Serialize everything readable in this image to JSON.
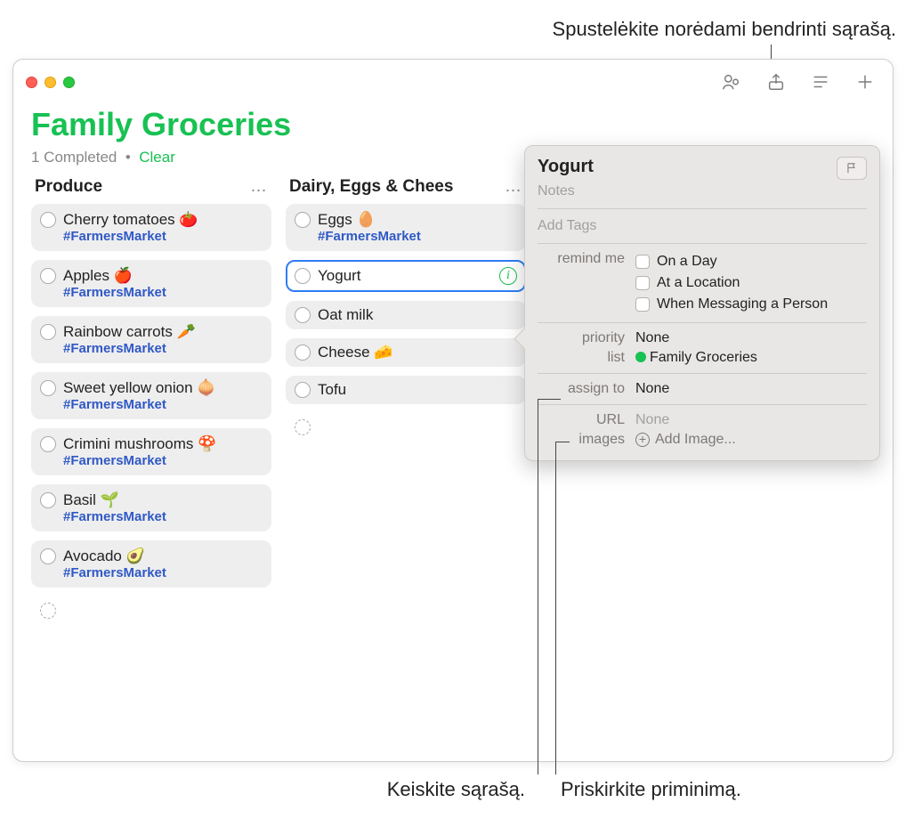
{
  "annotations": {
    "top": "Spustelėkite norėdami bendrinti sąrašą.",
    "bottom_left": "Keiskite sąrašą.",
    "bottom_right": "Priskirkite priminimą."
  },
  "list": {
    "title": "Family Groceries",
    "completed_count": "1 Completed",
    "dot": "•",
    "clear": "Clear"
  },
  "columns": [
    {
      "title": "Produce",
      "items": [
        {
          "label": "Cherry tomatoes 🍅",
          "tag": "#FarmersMarket"
        },
        {
          "label": "Apples 🍎",
          "tag": "#FarmersMarket"
        },
        {
          "label": "Rainbow carrots 🥕",
          "tag": "#FarmersMarket"
        },
        {
          "label": "Sweet yellow onion 🧅",
          "tag": "#FarmersMarket"
        },
        {
          "label": "Crimini mushrooms 🍄",
          "tag": "#FarmersMarket"
        },
        {
          "label": "Basil 🌱",
          "tag": "#FarmersMarket"
        },
        {
          "label": "Avocado 🥑",
          "tag": "#FarmersMarket"
        }
      ]
    },
    {
      "title": "Dairy, Eggs & Chees",
      "items": [
        {
          "label": "Eggs 🥚",
          "tag": "#FarmersMarket"
        },
        {
          "label": "Yogurt",
          "selected": true
        },
        {
          "label": "Oat milk"
        },
        {
          "label": "Cheese 🧀"
        },
        {
          "label": "Tofu"
        }
      ]
    }
  ],
  "popover": {
    "title": "Yogurt",
    "notes_placeholder": "Notes",
    "tags_placeholder": "Add Tags",
    "remind_label": "remind me",
    "remind_options": [
      "On a Day",
      "At a Location",
      "When Messaging a Person"
    ],
    "priority_label": "priority",
    "priority_value": "None",
    "list_label": "list",
    "list_value": "Family Groceries",
    "assign_label": "assign to",
    "assign_value": "None",
    "url_label": "URL",
    "url_value": "None",
    "images_label": "images",
    "images_value": "Add Image..."
  }
}
